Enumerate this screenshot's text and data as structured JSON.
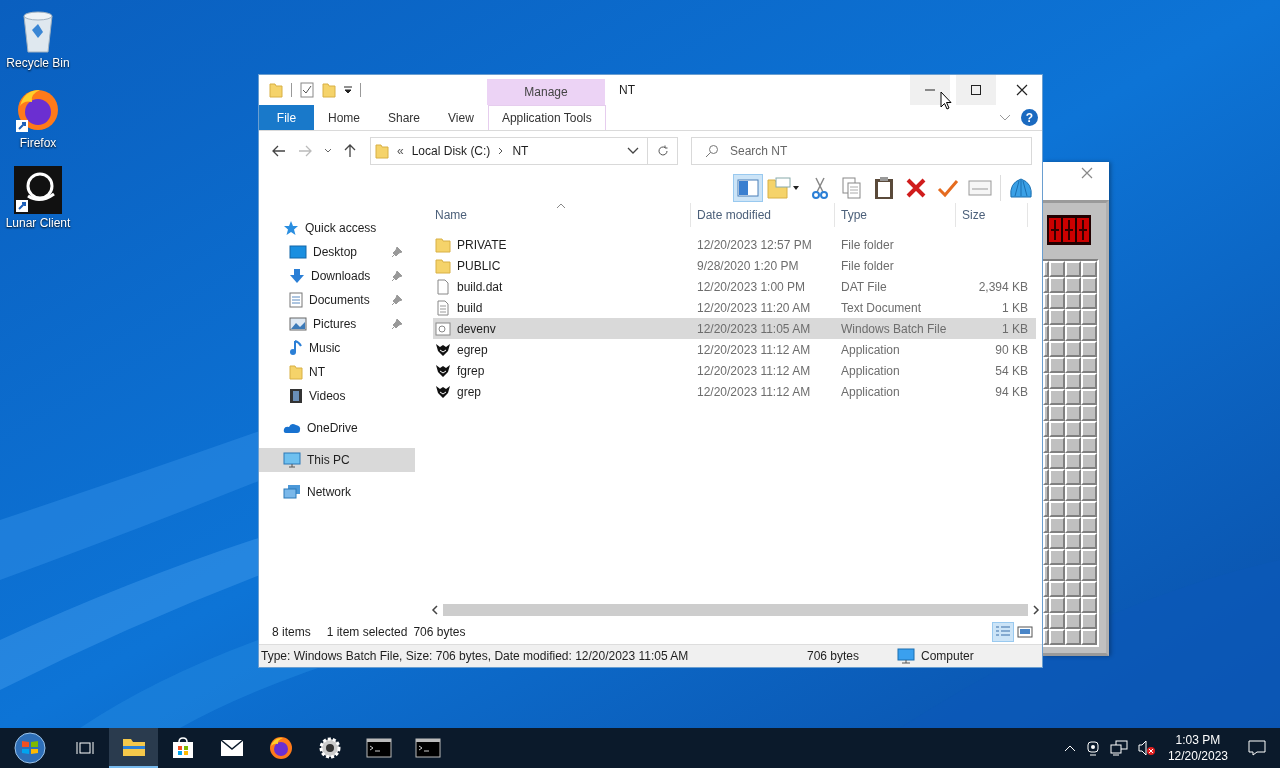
{
  "desktop_icons": [
    {
      "label": "Recycle Bin",
      "kind": "recycle"
    },
    {
      "label": "Firefox",
      "kind": "firefox"
    },
    {
      "label": "Lunar Client",
      "kind": "lunar"
    }
  ],
  "explorer": {
    "title": "NT",
    "context_group": "Manage",
    "help": "?",
    "ribbon_tabs": [
      {
        "label": "File",
        "kind": "file",
        "selected": false
      },
      {
        "label": "Home",
        "kind": "plain",
        "selected": false
      },
      {
        "label": "Share",
        "kind": "plain",
        "selected": false
      },
      {
        "label": "View",
        "kind": "plain",
        "selected": false
      },
      {
        "label": "Application Tools",
        "kind": "contextual",
        "selected": false
      }
    ],
    "address": {
      "prefix": "«",
      "path": [
        "Local Disk (C:)",
        "NT"
      ]
    },
    "search": {
      "placeholder": "Search NT"
    },
    "nav": [
      {
        "label": "Quick access",
        "kind": "star",
        "selected": false,
        "children": [
          {
            "label": "Desktop",
            "kind": "desktop",
            "pinned": true,
            "selected": false
          },
          {
            "label": "Downloads",
            "kind": "download",
            "pinned": true,
            "selected": false
          },
          {
            "label": "Documents",
            "kind": "docs",
            "pinned": true,
            "selected": false
          },
          {
            "label": "Pictures",
            "kind": "pictures",
            "pinned": true,
            "selected": false
          },
          {
            "label": "Music",
            "kind": "music",
            "pinned": false,
            "selected": false
          },
          {
            "label": "NT",
            "kind": "folder",
            "pinned": false,
            "selected": false
          },
          {
            "label": "Videos",
            "kind": "videos",
            "pinned": false,
            "selected": false
          }
        ]
      },
      {
        "label": "OneDrive",
        "kind": "cloud",
        "selected": false
      },
      {
        "label": "This PC",
        "kind": "pc",
        "selected": true
      },
      {
        "label": "Network",
        "kind": "network",
        "selected": false
      }
    ],
    "columns": [
      "Name",
      "Date modified",
      "Type",
      "Size"
    ],
    "rows": [
      {
        "name": "PRIVATE",
        "date": "12/20/2023 12:57 PM",
        "type": "File folder",
        "size": "",
        "kind": "folder",
        "selected": false
      },
      {
        "name": "PUBLIC",
        "date": "9/28/2020 1:20 PM",
        "type": "File folder",
        "size": "",
        "kind": "folder",
        "selected": false
      },
      {
        "name": "build.dat",
        "date": "12/20/2023 1:00 PM",
        "type": "DAT File",
        "size": "2,394 KB",
        "kind": "blank",
        "selected": false
      },
      {
        "name": "build",
        "date": "12/20/2023 11:20 AM",
        "type": "Text Document",
        "size": "1 KB",
        "kind": "text",
        "selected": false
      },
      {
        "name": "devenv",
        "date": "12/20/2023 11:05 AM",
        "type": "Windows Batch File",
        "size": "1 KB",
        "kind": "batch",
        "selected": true
      },
      {
        "name": "egrep",
        "date": "12/20/2023 11:12 AM",
        "type": "Application",
        "size": "90 KB",
        "kind": "app",
        "selected": false
      },
      {
        "name": "fgrep",
        "date": "12/20/2023 11:12 AM",
        "type": "Application",
        "size": "54 KB",
        "kind": "app",
        "selected": false
      },
      {
        "name": "grep",
        "date": "12/20/2023 11:12 AM",
        "type": "Application",
        "size": "94 KB",
        "kind": "app",
        "selected": false
      }
    ],
    "status": {
      "count": "8 items",
      "selection": "1 item selected",
      "size": "706 bytes"
    },
    "details_bar": {
      "info": "Type: Windows Batch File, Size: 706 bytes, Date modified: 12/20/2023 11:05 AM",
      "size": "706 bytes",
      "zone": "Computer"
    }
  },
  "taskbar": {
    "apps": [
      {
        "kind": "start",
        "active": false
      },
      {
        "kind": "taskview",
        "active": false
      },
      {
        "kind": "explorer",
        "active": true
      },
      {
        "kind": "store",
        "active": false
      },
      {
        "kind": "mail",
        "active": false
      },
      {
        "kind": "firefox",
        "active": false
      },
      {
        "kind": "gear",
        "active": false
      },
      {
        "kind": "terminal",
        "active": false
      },
      {
        "kind": "terminal",
        "active": false
      }
    ],
    "time": "1:03 PM",
    "date": "12/20/2023"
  }
}
